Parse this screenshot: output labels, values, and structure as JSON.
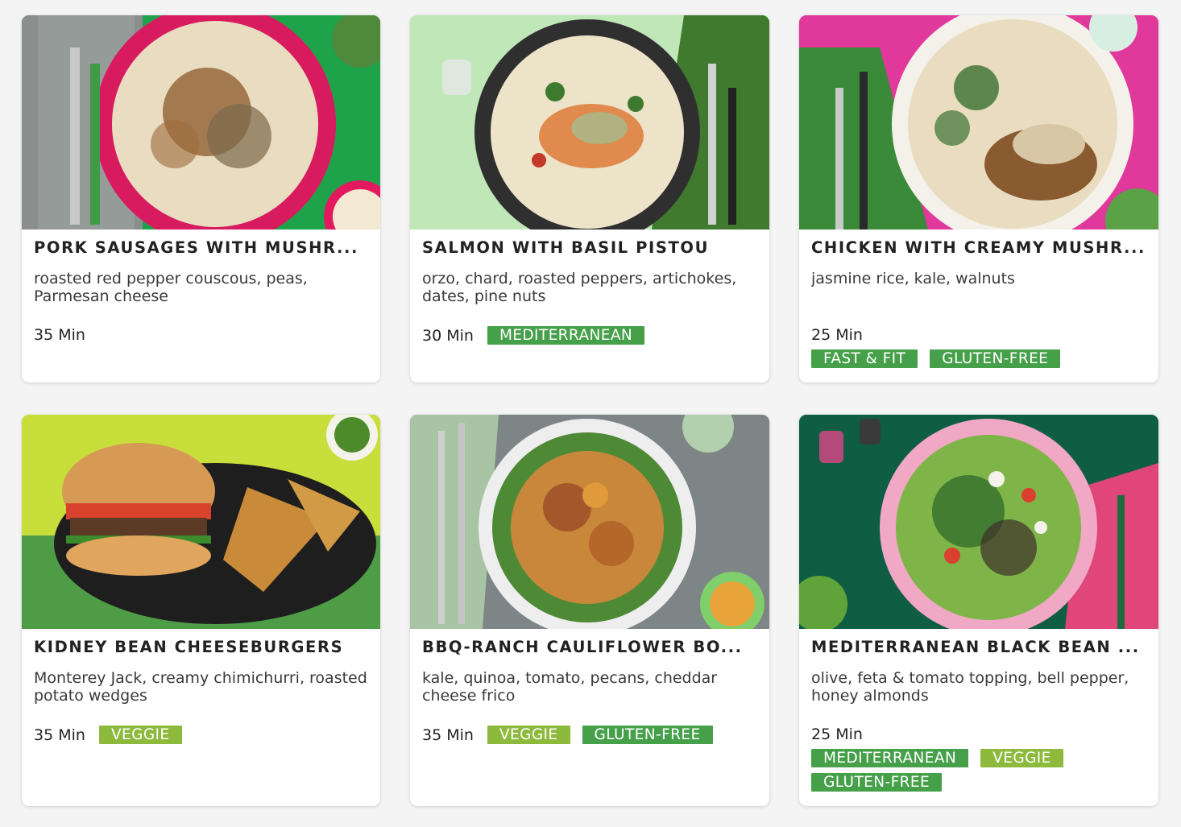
{
  "colors": {
    "tag_dark_green": "#46a04a",
    "tag_lime": "#8dba3c",
    "card_bg": "#ffffff",
    "page_bg": "#f4f4f4"
  },
  "recipes": [
    {
      "title": "PORK SAUSAGES WITH MUSHR...",
      "description": "roasted red pepper couscous, peas, Parmesan cheese",
      "time": "35 Min",
      "tags": []
    },
    {
      "title": "SALMON WITH BASIL PISTOU",
      "description": "orzo, chard, roasted peppers, artichokes, dates, pine nuts",
      "time": "30 Min",
      "tags": [
        {
          "label": "MEDITERRANEAN",
          "color": "green"
        }
      ]
    },
    {
      "title": "CHICKEN WITH CREAMY MUSHR...",
      "description": "jasmine rice, kale, walnuts",
      "time": "25 Min",
      "tags": [
        {
          "label": "FAST & FIT",
          "color": "green"
        },
        {
          "label": "GLUTEN-FREE",
          "color": "green"
        }
      ]
    },
    {
      "title": "KIDNEY BEAN CHEESEBURGERS",
      "description": "Monterey Jack, creamy chimichurri, roasted potato wedges",
      "time": "35 Min",
      "tags": [
        {
          "label": "VEGGIE",
          "color": "lime"
        }
      ]
    },
    {
      "title": "BBQ-RANCH CAULIFLOWER BO...",
      "description": "kale, quinoa, tomato, pecans, cheddar cheese frico",
      "time": "35 Min",
      "tags": [
        {
          "label": "VEGGIE",
          "color": "lime"
        },
        {
          "label": "GLUTEN-FREE",
          "color": "green"
        }
      ]
    },
    {
      "title": "MEDITERRANEAN BLACK BEAN ...",
      "description": "olive, feta & tomato topping, bell pepper, honey almonds",
      "time": "25 Min",
      "tags": [
        {
          "label": "MEDITERRANEAN",
          "color": "green"
        },
        {
          "label": "VEGGIE",
          "color": "lime"
        },
        {
          "label": "GLUTEN-FREE",
          "color": "green"
        }
      ]
    }
  ]
}
